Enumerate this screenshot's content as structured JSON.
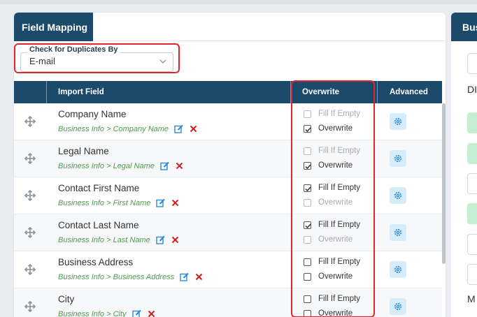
{
  "panel": {
    "title": "Field Mapping"
  },
  "duplicates": {
    "legend": "Check for Duplicates By",
    "value": "E-mail"
  },
  "columns": {
    "import_field": "Import Field",
    "overwrite": "Overwrite",
    "advanced": "Advanced"
  },
  "rows": [
    {
      "name": "Company Name",
      "path": "Business Info > Company Name",
      "fill_if_empty": {
        "label": "Fill If Empty",
        "checked": false,
        "disabled": true
      },
      "overwrite": {
        "label": "Overwrite",
        "checked": true,
        "disabled": false
      }
    },
    {
      "name": "Legal Name",
      "path": "Business Info > Legal Name",
      "fill_if_empty": {
        "label": "Fill If Empty",
        "checked": false,
        "disabled": true
      },
      "overwrite": {
        "label": "Overwrite",
        "checked": true,
        "disabled": false
      }
    },
    {
      "name": "Contact First Name",
      "path": "Business Info > First Name",
      "fill_if_empty": {
        "label": "Fill If Empty",
        "checked": true,
        "disabled": false
      },
      "overwrite": {
        "label": "Overwrite",
        "checked": false,
        "disabled": true
      }
    },
    {
      "name": "Contact Last Name",
      "path": "Business Info > Last Name",
      "fill_if_empty": {
        "label": "Fill If Empty",
        "checked": true,
        "disabled": false
      },
      "overwrite": {
        "label": "Overwrite",
        "checked": false,
        "disabled": true
      }
    },
    {
      "name": "Business Address",
      "path": "Business Info > Business Address",
      "fill_if_empty": {
        "label": "Fill If Empty",
        "checked": false,
        "disabled": false
      },
      "overwrite": {
        "label": "Overwrite",
        "checked": false,
        "disabled": false
      }
    },
    {
      "name": "City",
      "path": "Business Info > City",
      "fill_if_empty": {
        "label": "Fill If Empty",
        "checked": false,
        "disabled": false
      },
      "overwrite": {
        "label": "Overwrite",
        "checked": false,
        "disabled": false
      }
    }
  ],
  "right_panel": {
    "title": "Bus",
    "text_1": "DI",
    "text_2": "M"
  },
  "icons": {
    "drag": "drag-move-icon",
    "edit": "edit-icon",
    "delete": "delete-x-icon",
    "advanced": "gear-icon",
    "chevron": "chevron-down-icon"
  },
  "colors": {
    "header_bg": "#1b4a6b",
    "highlight": "#e0262b",
    "path_text": "#4d9a4d",
    "edit_icon": "#2a8ad8",
    "delete_icon": "#d42020",
    "advanced_bg": "#d6ecfb"
  }
}
